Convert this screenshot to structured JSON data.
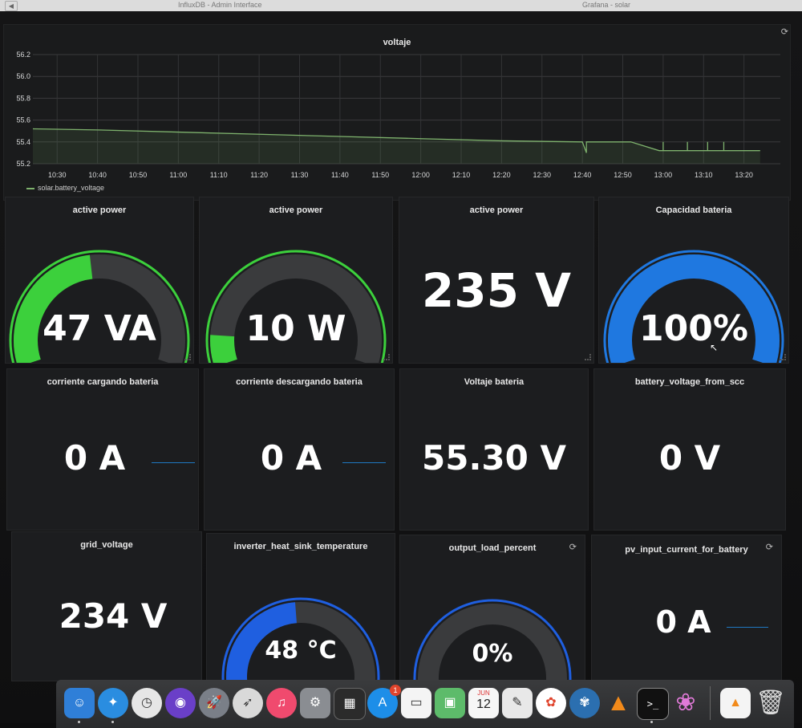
{
  "browser": {
    "tab_left": "InfluxDB - Admin Interface",
    "tab_right": "Grafana - solar"
  },
  "voltage_graph": {
    "title": "voltaje",
    "legend": "solar.battery_voltage",
    "series_color": "#7eb26d"
  },
  "chart_data": {
    "type": "line",
    "title": "voltaje",
    "xlabel": "",
    "ylabel": "",
    "ylim": [
      55.2,
      56.2
    ],
    "yticks": [
      "56.2",
      "56.0",
      "55.8",
      "55.6",
      "55.4",
      "55.2"
    ],
    "xticks": [
      "10:30",
      "10:40",
      "10:50",
      "11:00",
      "11:10",
      "11:20",
      "11:30",
      "11:40",
      "11:50",
      "12:00",
      "12:10",
      "12:20",
      "12:30",
      "12:40",
      "12:50",
      "13:00",
      "13:10",
      "13:20"
    ],
    "grid": true,
    "legend_position": "bottom-left",
    "series": [
      {
        "name": "solar.battery_voltage",
        "x": [
          "10:24",
          "10:40",
          "11:00",
          "11:20",
          "11:40",
          "12:00",
          "12:20",
          "12:40",
          "12:41",
          "12:41",
          "12:50",
          "12:52",
          "12:59",
          "13:00",
          "13:00",
          "13:00",
          "13:06",
          "13:06",
          "13:06",
          "13:11",
          "13:11",
          "13:11",
          "13:15",
          "13:15",
          "13:15",
          "13:24"
        ],
        "y": [
          55.52,
          55.51,
          55.49,
          55.47,
          55.45,
          55.43,
          55.41,
          55.4,
          55.3,
          55.4,
          55.4,
          55.4,
          55.32,
          55.32,
          55.4,
          55.32,
          55.32,
          55.4,
          55.32,
          55.32,
          55.4,
          55.32,
          55.32,
          55.4,
          55.32,
          55.32
        ]
      }
    ]
  },
  "panels": [
    {
      "title": "active power",
      "value": "47 VA",
      "kind": "gauge",
      "fraction": 0.47,
      "color": "#3cd03c"
    },
    {
      "title": "active power",
      "value": "10 W",
      "kind": "gauge",
      "fraction": 0.1,
      "color": "#3cd03c"
    },
    {
      "title": "active power",
      "value": "235 V",
      "kind": "stat"
    },
    {
      "title": "Capacidad bateria",
      "value": "100%",
      "kind": "gauge",
      "fraction": 1.0,
      "color": "#1f78e0"
    },
    {
      "title": "corriente cargando bateria",
      "value": "0 A",
      "kind": "spark"
    },
    {
      "title": "corriente descargando bateria",
      "value": "0 A",
      "kind": "spark"
    },
    {
      "title": "Voltaje bateria",
      "value": "55.30 V",
      "kind": "stat"
    },
    {
      "title": "battery_voltage_from_scc",
      "value": "0 V",
      "kind": "stat"
    },
    {
      "title": "grid_voltage",
      "value": "234 V",
      "kind": "stat"
    },
    {
      "title": "inverter_heat_sink_temperature",
      "value": "48 °C",
      "kind": "gauge",
      "fraction": 0.48,
      "color": "#1f5fe0"
    },
    {
      "title": "output_load_percent",
      "value": "0%",
      "kind": "gauge",
      "fraction": 0.0,
      "color": "#1f5fe0"
    },
    {
      "title": "pv_input_current_for_battery",
      "value": "0 A",
      "kind": "spark"
    }
  ],
  "dock": {
    "badge": "1",
    "calendar_month": "JUN",
    "calendar_day": "12"
  }
}
